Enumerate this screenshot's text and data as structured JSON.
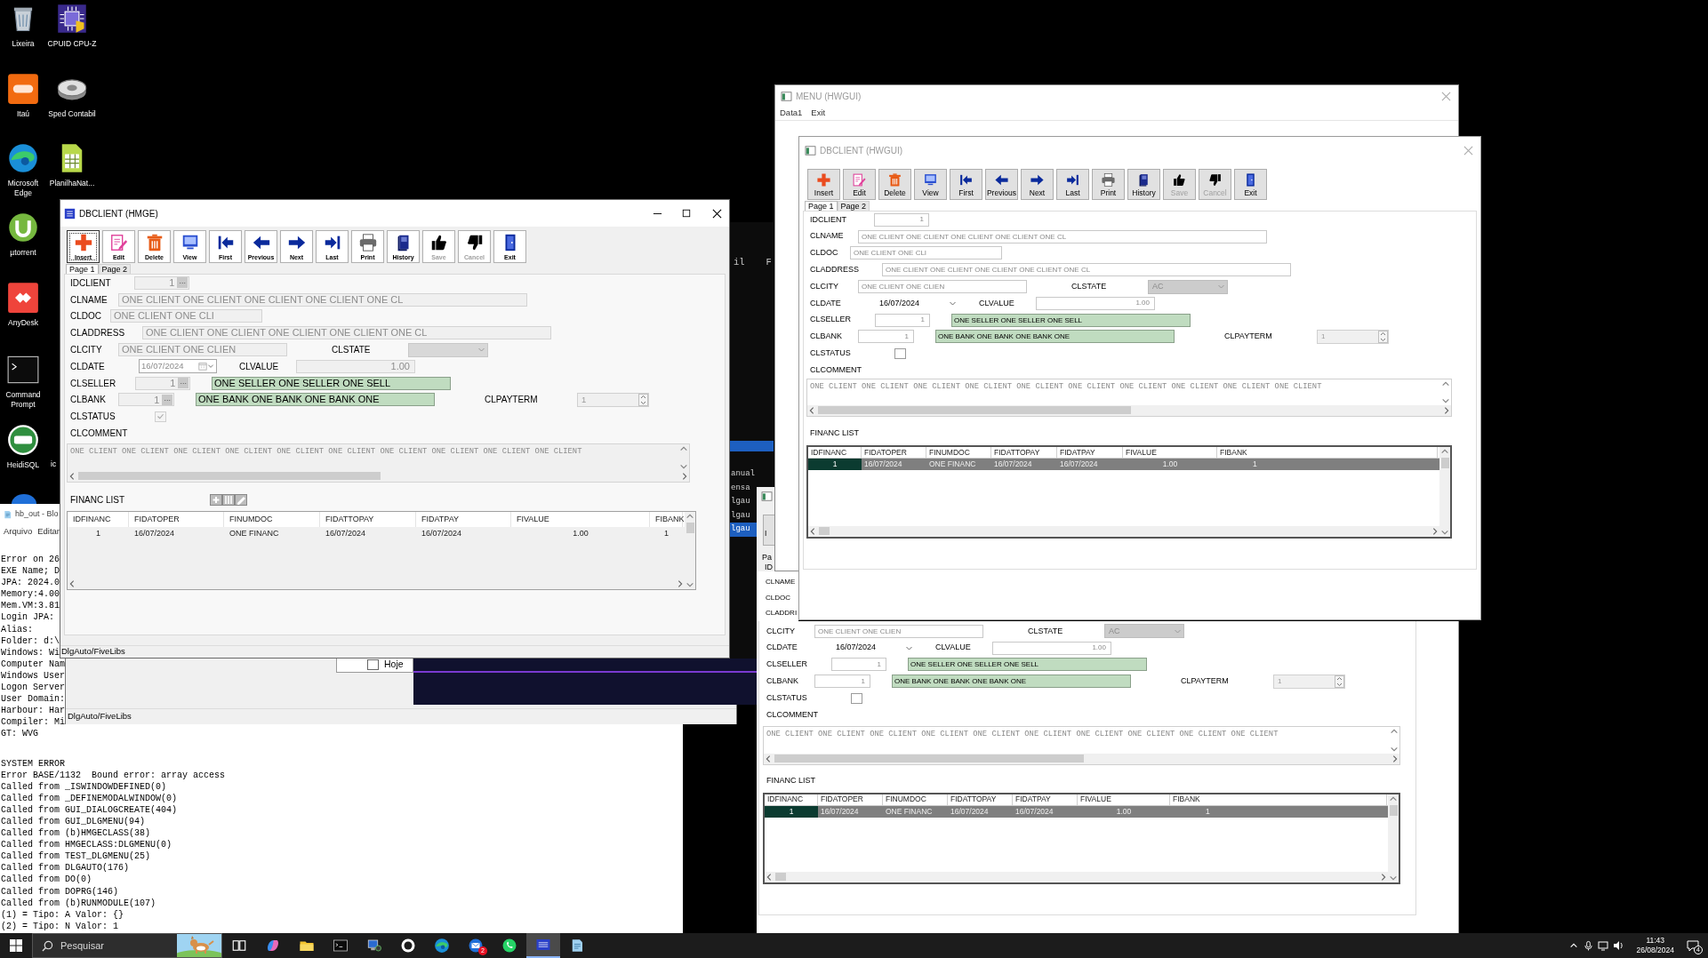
{
  "desktop": {
    "column_1": [
      {
        "label": "Lixeira",
        "kind": "bin"
      },
      {
        "label": "Itaú",
        "kind": "orange-tile"
      },
      {
        "label": "Microsoft Edge",
        "kind": "browser"
      },
      {
        "label": "µtorrent",
        "kind": "torrent"
      },
      {
        "label": "AnyDesk",
        "kind": "diamond-tile"
      },
      {
        "label": "Command Prompt",
        "kind": "terminal"
      },
      {
        "label": "HeidiSQL",
        "kind": "badge"
      },
      {
        "kind": "round"
      }
    ],
    "column_2": [
      {
        "label": "CPUID CPU-Z",
        "kind": "chip"
      },
      {
        "label": "Sped Contabil",
        "kind": "disc"
      },
      {
        "label": "PlanilhaNat...",
        "kind": "spreadsheet"
      }
    ],
    "fragment": "ic"
  },
  "notepad": {
    "title": "hb_out - Blo",
    "menu": [
      "Arquivo",
      "Editar"
    ],
    "header_lines": [
      "Error on 26",
      "EXE Name; D",
      "JPA: 2024.0",
      "Memory:4.00",
      "Mem.VM:3.81",
      "Login JPA:",
      "Alias:",
      "Folder: d:\\",
      "Windows: Wi",
      "Computer Nam",
      "Windows User",
      "Logon Server",
      "User Domain:",
      "Harbour: Har",
      "Compiler: Mi",
      "GT: WVG"
    ],
    "error_lines": [
      "SYSTEM ERROR",
      "Error BASE/1132  Bound error: array access",
      "Called from _ISWINDOWDEFINED(0)",
      "Called from _DEFINEMODALWINDOW(0)",
      "Called from GUI_DIALOGCREATE(404)",
      "Called from GUI_DLGMENU(94)",
      "Called from (b)HMGECLASS(38)",
      "Called from HMGECLASS:DLGMENU(0)",
      "Called from TEST_DLGMENU(25)",
      "Called from DLGAUTO(176)",
      "Called from DO(0)",
      "Called from DOPRG(146)",
      "Called from (b)RUNMODULE(107)",
      "(1) = Tipo: A Valor: {}",
      "(2) = Tipo: N Valor: 1"
    ]
  },
  "dialog_behind": {
    "status": "DlgAuto/FiveLibs"
  },
  "hoje_window": {
    "label": "Hoje",
    "checked": false
  },
  "terminal": {
    "top": [
      "il",
      "F"
    ],
    "lines": [
      {
        "text": "anual",
        "selected": false
      },
      {
        "text": "ensa",
        "selected": false
      },
      {
        "text": "lgau",
        "selected": false
      },
      {
        "text": "lgau",
        "selected": false
      },
      {
        "text": "lgau",
        "selected": true
      }
    ]
  },
  "dbclient_bottom": {
    "kind": "hwgui",
    "edge": {
      "button": "I",
      "tab": "Pa",
      "labels": [
        "ID",
        "CLNAME",
        "CLDOC",
        "CLADDRI"
      ]
    },
    "rows": [
      {
        "kind": "city",
        "items": [
          {
            "kind": "label",
            "text": "CLCITY"
          },
          {
            "kind": "text",
            "value": "ONE CLIENT ONE CLIEN"
          },
          {
            "kind": "label",
            "text": "CLSTATE"
          },
          {
            "kind": "combo",
            "value": "AC"
          }
        ]
      },
      {
        "kind": "date",
        "items": [
          {
            "kind": "label",
            "text": "CLDATE"
          },
          {
            "kind": "date",
            "value": "16/07/2024"
          },
          {
            "kind": "label",
            "text": "CLVALUE"
          },
          {
            "kind": "number",
            "value": "1.00"
          }
        ]
      },
      {
        "kind": "seller",
        "items": [
          {
            "kind": "label",
            "text": "CLSELLER"
          },
          {
            "kind": "number",
            "value": "1"
          },
          {
            "kind": "lookup",
            "value": "ONE SELLER ONE SELLER ONE SELL"
          }
        ]
      },
      {
        "kind": "bank",
        "items": [
          {
            "kind": "label",
            "text": "CLBANK"
          },
          {
            "kind": "number",
            "value": "1"
          },
          {
            "kind": "lookup",
            "value": "ONE BANK ONE BANK ONE BANK ONE"
          },
          {
            "kind": "label",
            "text": "CLPAYTERM"
          },
          {
            "kind": "spinner",
            "value": "1"
          }
        ]
      },
      {
        "kind": "status",
        "items": [
          {
            "kind": "label",
            "text": "CLSTATUS"
          },
          {
            "kind": "checkbox",
            "checked": false
          }
        ]
      },
      {
        "kind": "comment",
        "items": [
          {
            "kind": "label",
            "text": "CLCOMMENT"
          }
        ]
      }
    ],
    "comment": "ONE CLIENT ONE CLIENT ONE CLIENT ONE CLIENT ONE CLIENT ONE CLIENT ONE CLIENT ONE CLIENT ONE CLIENT ONE CLIENT",
    "list_title": "FINANC LIST",
    "grid": {
      "columns": [
        "IDFINANC",
        "FIDATOPER",
        "FINUMDOC",
        "FIDATTOPAY",
        "FIDATPAY",
        "FIVALUE",
        "FIBANK"
      ],
      "rows": [
        {
          "cells": [
            "1",
            "16/07/2024",
            "ONE FINANC",
            "16/07/2024",
            "16/07/2024",
            "1.00",
            "1"
          ],
          "selected": true
        }
      ]
    }
  },
  "menu_window": {
    "title": "MENU (HWGUI)",
    "active": false,
    "menu": [
      "Data1",
      "Exit"
    ]
  },
  "dbclient_right": {
    "kind": "hwgui",
    "title": "DBCLIENT (HWGUI)",
    "active": false,
    "toolbar": [
      {
        "label": "Insert",
        "disabled": false
      },
      {
        "label": "Edit",
        "disabled": false
      },
      {
        "label": "Delete",
        "disabled": false
      },
      {
        "label": "View",
        "disabled": false
      },
      {
        "label": "First",
        "disabled": false
      },
      {
        "label": "Previous",
        "disabled": false
      },
      {
        "label": "Next",
        "disabled": false
      },
      {
        "label": "Last",
        "disabled": false
      },
      {
        "label": "Print",
        "disabled": false
      },
      {
        "label": "History",
        "disabled": false
      },
      {
        "label": "Save",
        "disabled": true
      },
      {
        "label": "Cancel",
        "disabled": true
      },
      {
        "label": "Exit",
        "disabled": false
      }
    ],
    "tabs": [
      {
        "label": "Page 1",
        "selected": true
      },
      {
        "label": "Page 2",
        "selected": false
      }
    ],
    "rows": [
      {
        "kind": "id",
        "items": [
          {
            "kind": "label",
            "text": "IDCLIENT"
          },
          {
            "kind": "number",
            "value": "1"
          }
        ]
      },
      {
        "kind": "name",
        "items": [
          {
            "kind": "label",
            "text": "CLNAME"
          },
          {
            "kind": "text",
            "value": "ONE CLIENT ONE CLIENT ONE CLIENT ONE CLIENT ONE CL"
          }
        ]
      },
      {
        "kind": "doc",
        "items": [
          {
            "kind": "label",
            "text": "CLDOC"
          },
          {
            "kind": "text",
            "value": "ONE CLIENT ONE CLI"
          }
        ]
      },
      {
        "kind": "address",
        "items": [
          {
            "kind": "label",
            "text": "CLADDRESS"
          },
          {
            "kind": "text",
            "value": "ONE CLIENT ONE CLIENT ONE CLIENT ONE CLIENT ONE CL"
          }
        ]
      },
      {
        "kind": "city",
        "items": [
          {
            "kind": "label",
            "text": "CLCITY"
          },
          {
            "kind": "text",
            "value": "ONE CLIENT ONE CLIEN"
          },
          {
            "kind": "label",
            "text": "CLSTATE"
          },
          {
            "kind": "combo",
            "value": "AC"
          }
        ]
      },
      {
        "kind": "date",
        "items": [
          {
            "kind": "label",
            "text": "CLDATE"
          },
          {
            "kind": "date",
            "value": "16/07/2024"
          },
          {
            "kind": "label",
            "text": "CLVALUE"
          },
          {
            "kind": "number",
            "value": "1.00"
          }
        ]
      },
      {
        "kind": "seller",
        "items": [
          {
            "kind": "label",
            "text": "CLSELLER"
          },
          {
            "kind": "number",
            "value": "1"
          },
          {
            "kind": "lookup",
            "value": "ONE SELLER ONE SELLER ONE SELL"
          }
        ]
      },
      {
        "kind": "bank",
        "items": [
          {
            "kind": "label",
            "text": "CLBANK"
          },
          {
            "kind": "number",
            "value": "1"
          },
          {
            "kind": "lookup",
            "value": "ONE BANK ONE BANK ONE BANK ONE"
          },
          {
            "kind": "label",
            "text": "CLPAYTERM"
          },
          {
            "kind": "spinner",
            "value": "1"
          }
        ]
      },
      {
        "kind": "status",
        "items": [
          {
            "kind": "label",
            "text": "CLSTATUS"
          },
          {
            "kind": "checkbox",
            "checked": false
          }
        ]
      },
      {
        "kind": "comment",
        "items": [
          {
            "kind": "label",
            "text": "CLCOMMENT"
          }
        ]
      }
    ],
    "comment": "ONE CLIENT ONE CLIENT ONE CLIENT ONE CLIENT ONE CLIENT ONE CLIENT ONE CLIENT ONE CLIENT ONE CLIENT ONE CLIENT",
    "list_title": "FINANC LIST",
    "grid": {
      "columns": [
        "IDFINANC",
        "FIDATOPER",
        "FINUMDOC",
        "FIDATTOPAY",
        "FIDATPAY",
        "FIVALUE",
        "FIBANK"
      ],
      "rows": [
        {
          "cells": [
            "1",
            "16/07/2024",
            "ONE FINANC",
            "16/07/2024",
            "16/07/2024",
            "1.00",
            "1"
          ],
          "selected": true
        }
      ]
    }
  },
  "dbclient_left": {
    "kind": "hmge",
    "title": "DBCLIENT (HMGE)",
    "active": true,
    "toolbar": [
      {
        "label": "Insert",
        "disabled": false,
        "focused": true
      },
      {
        "label": "Edit",
        "disabled": false,
        "focused": false
      },
      {
        "label": "Delete",
        "disabled": false,
        "focused": false
      },
      {
        "label": "View",
        "disabled": false,
        "focused": false
      },
      {
        "label": "First",
        "disabled": false,
        "focused": false
      },
      {
        "label": "Previous",
        "disabled": false,
        "focused": false
      },
      {
        "label": "Next",
        "disabled": false,
        "focused": false
      },
      {
        "label": "Last",
        "disabled": false,
        "focused": false
      },
      {
        "label": "Print",
        "disabled": false,
        "focused": false
      },
      {
        "label": "History",
        "disabled": false,
        "focused": false
      },
      {
        "label": "Save",
        "disabled": true,
        "focused": false
      },
      {
        "label": "Cancel",
        "disabled": true,
        "focused": false
      },
      {
        "label": "Exit",
        "disabled": false,
        "focused": false
      }
    ],
    "tabs": [
      {
        "label": "Page 1",
        "selected": true
      },
      {
        "label": "Page 2",
        "selected": false
      }
    ],
    "rows": [
      {
        "kind": "id",
        "items": [
          {
            "kind": "label",
            "text": "IDCLIENT"
          },
          {
            "kind": "number",
            "value": "1",
            "button": "..."
          }
        ]
      },
      {
        "kind": "name",
        "items": [
          {
            "kind": "label",
            "text": "CLNAME"
          },
          {
            "kind": "text",
            "value": "ONE CLIENT ONE CLIENT ONE CLIENT ONE CLIENT ONE CL"
          }
        ]
      },
      {
        "kind": "doc",
        "items": [
          {
            "kind": "label",
            "text": "CLDOC"
          },
          {
            "kind": "text",
            "value": "ONE CLIENT ONE CLI"
          }
        ]
      },
      {
        "kind": "address",
        "items": [
          {
            "kind": "label",
            "text": "CLADDRESS"
          },
          {
            "kind": "text",
            "value": "ONE CLIENT ONE CLIENT ONE CLIENT ONE CLIENT ONE CL"
          }
        ]
      },
      {
        "kind": "city",
        "items": [
          {
            "kind": "label",
            "text": "CLCITY"
          },
          {
            "kind": "text",
            "value": "ONE CLIENT ONE CLIEN"
          },
          {
            "kind": "label",
            "text": "CLSTATE"
          },
          {
            "kind": "combo"
          }
        ]
      },
      {
        "kind": "date",
        "items": [
          {
            "kind": "label",
            "text": "CLDATE"
          },
          {
            "kind": "date",
            "value": "16/07/2024"
          },
          {
            "kind": "label",
            "text": "CLVALUE"
          },
          {
            "kind": "number",
            "value": "1.00"
          }
        ]
      },
      {
        "kind": "seller",
        "items": [
          {
            "kind": "label",
            "text": "CLSELLER"
          },
          {
            "kind": "number",
            "value": "1",
            "button": "..."
          },
          {
            "kind": "lookup",
            "value": "ONE SELLER ONE SELLER ONE SELL"
          }
        ]
      },
      {
        "kind": "bank",
        "items": [
          {
            "kind": "label",
            "text": "CLBANK"
          },
          {
            "kind": "number",
            "value": "1",
            "button": "..."
          },
          {
            "kind": "lookup",
            "value": "ONE BANK ONE BANK ONE BANK ONE"
          },
          {
            "kind": "label",
            "text": "CLPAYTERM"
          },
          {
            "kind": "spinner",
            "value": "1"
          }
        ]
      },
      {
        "kind": "status",
        "items": [
          {
            "kind": "label",
            "text": "CLSTATUS"
          },
          {
            "kind": "checkbox",
            "checked": true
          }
        ]
      },
      {
        "kind": "comment",
        "items": [
          {
            "kind": "label",
            "text": "CLCOMMENT"
          }
        ]
      }
    ],
    "comment": "ONE CLIENT ONE CLIENT ONE CLIENT ONE CLIENT ONE CLIENT ONE CLIENT ONE CLIENT ONE CLIENT ONE CLIENT ONE CLIENT",
    "list_title": "FINANC LIST",
    "list_tools": true,
    "grid": {
      "columns": [
        "IDFINANC",
        "FIDATOPER",
        "FINUMDOC",
        "FIDATTOPAY",
        "FIDATPAY",
        "FIVALUE",
        "FIBANK"
      ],
      "rows": [
        {
          "cells": [
            "1",
            "16/07/2024",
            "ONE FINANC",
            "16/07/2024",
            "16/07/2024",
            "1.00",
            "1"
          ],
          "selected": false
        }
      ]
    },
    "status": "DlgAuto/FiveLibs"
  },
  "taskbar": {
    "search": {
      "placeholder": "Pesquisar"
    },
    "apps": [
      {
        "kind": "taskview",
        "active": false
      },
      {
        "kind": "copilot",
        "active": false
      },
      {
        "kind": "folder",
        "active": false
      },
      {
        "kind": "terminal",
        "active": false
      },
      {
        "kind": "remote",
        "active": false
      },
      {
        "kind": "github",
        "active": false
      },
      {
        "kind": "edge",
        "active": false
      },
      {
        "kind": "mail",
        "active": false,
        "badge": "2"
      },
      {
        "kind": "whatsapp",
        "active": false
      },
      {
        "kind": "jpa",
        "active": true
      },
      {
        "kind": "notepad",
        "active": false
      }
    ],
    "time": "11:43",
    "date": "26/08/2024",
    "notifications": "4"
  }
}
